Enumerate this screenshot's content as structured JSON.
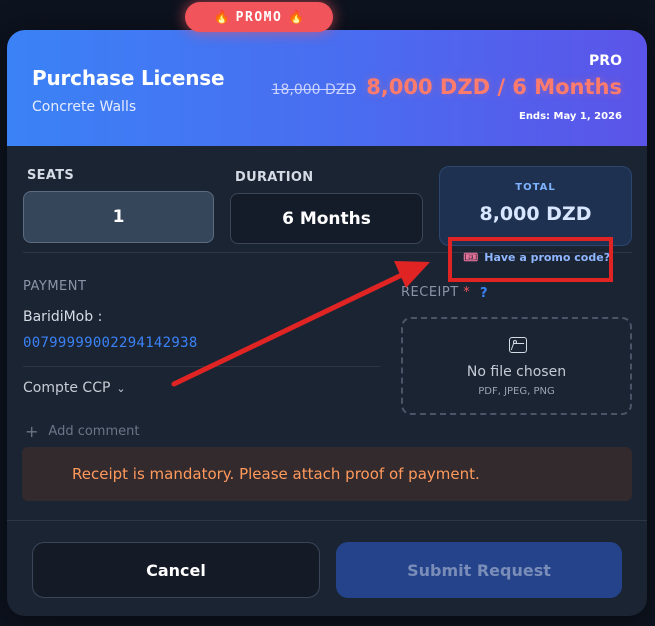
{
  "promo_badge": {
    "fire_icon": "🔥",
    "label": "PROMO"
  },
  "header": {
    "title": "Purchase License",
    "subtitle": "Concrete Walls",
    "plan": "PRO",
    "old_price": "18,000 DZD",
    "new_price": "8,000 DZD / 6 Months",
    "ends": "Ends: May 1, 2026"
  },
  "seats": {
    "label": "SEATS",
    "value": "1"
  },
  "duration": {
    "label": "DURATION",
    "value": "6 Months"
  },
  "total": {
    "label": "TOTAL",
    "value": "8,000 DZD"
  },
  "promo_link": {
    "icon": "🎟",
    "label": "Have a promo code?"
  },
  "payment": {
    "label": "PAYMENT",
    "method": "BaridiMob :",
    "account": "00799999002294142938",
    "select_value": "Compte CCP"
  },
  "receipt": {
    "label": "RECEIPT",
    "required_mark": "*",
    "help": "?",
    "no_file": "No file chosen",
    "types": "PDF, JPEG, PNG"
  },
  "comment": {
    "plus": "+",
    "label": "Add comment"
  },
  "alert": {
    "text": "Receipt is mandatory. Please attach proof of payment."
  },
  "buttons": {
    "cancel": "Cancel",
    "submit": "Submit Request"
  },
  "colors": {
    "header_start": "#3b82f6",
    "header_end": "#5b54e8",
    "promo_badge": "#f2545b",
    "new_price": "#ff7b6b",
    "account_link": "#3b82f6",
    "alert_text": "#ff9a5c",
    "annotation": "#e02424"
  }
}
